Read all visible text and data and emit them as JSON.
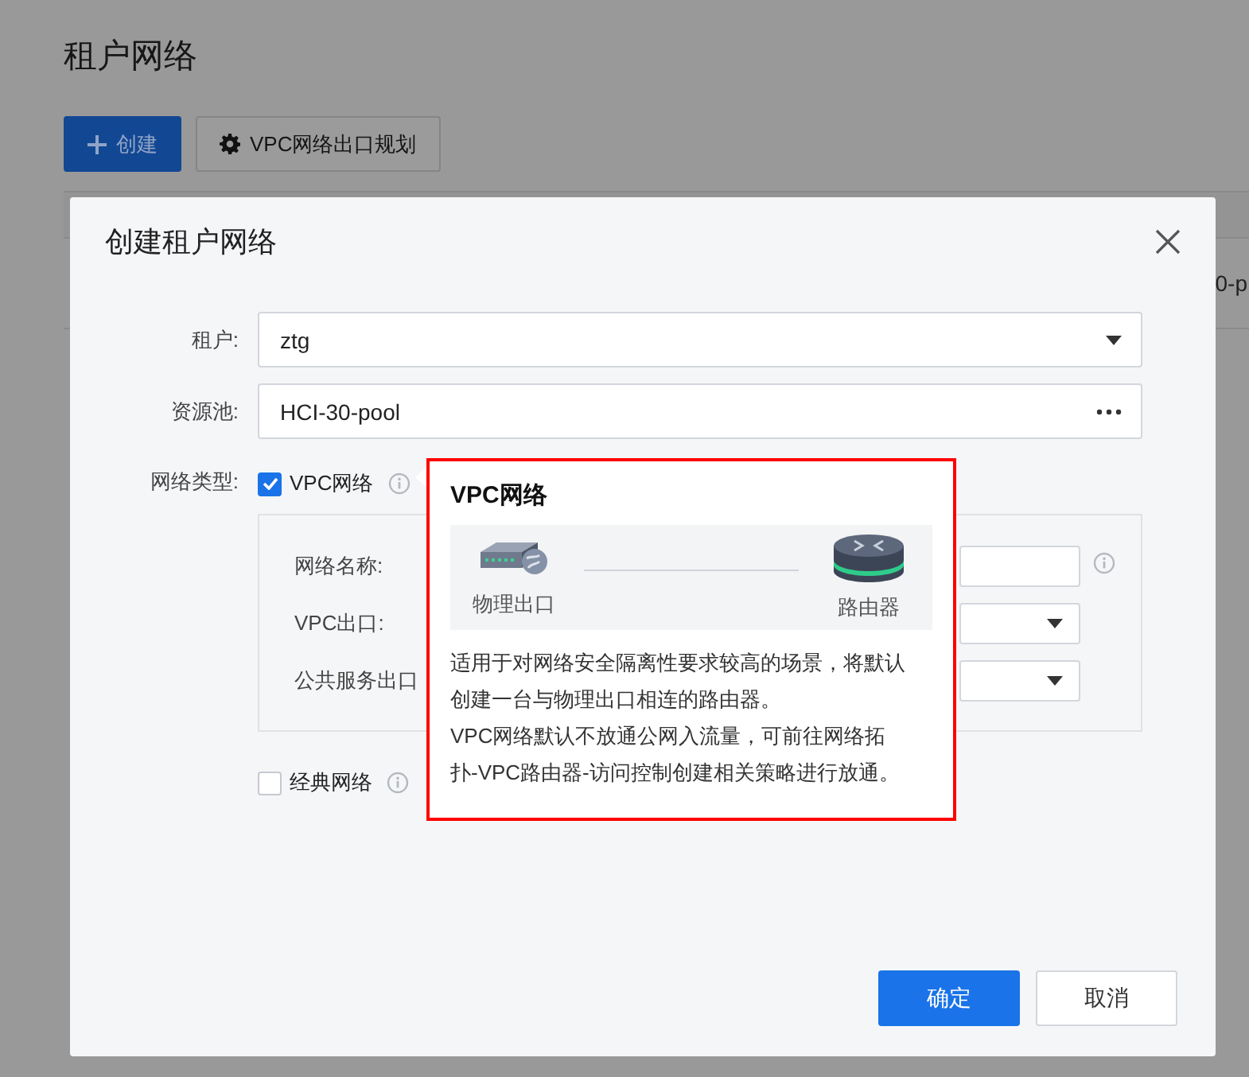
{
  "page": {
    "title": "租户网络",
    "toolbar": [
      {
        "label": "创建",
        "kind": "primary"
      },
      {
        "label": "VPC网络出口规划",
        "kind": "default"
      }
    ],
    "table": {
      "rows": [
        {
          "column_4": "0-p"
        }
      ]
    }
  },
  "dialog": {
    "title": "创建租户网络",
    "fields": [
      {
        "label": "租户:",
        "value": "ztg",
        "kind": "select"
      },
      {
        "label": "资源池:",
        "value": "HCI-30-pool",
        "kind": "picker"
      }
    ],
    "network_type": {
      "label": "网络类型:",
      "options": [
        {
          "label": "VPC网络",
          "checked": true,
          "fields": [
            {
              "label": "网络名称:",
              "kind": "input"
            },
            {
              "label": "VPC出口:",
              "kind": "select"
            },
            {
              "label": "公共服务出口",
              "kind": "select"
            }
          ]
        },
        {
          "label": "经典网络",
          "checked": false
        }
      ]
    },
    "buttons": [
      {
        "label": "确定",
        "kind": "primary"
      },
      {
        "label": "取消",
        "kind": "default"
      }
    ]
  },
  "tooltip": {
    "title": "VPC网络",
    "diagram": {
      "left": "物理出口",
      "right": "路由器"
    },
    "paragraphs": [
      "适用于对网络安全隔离性要求较高的场景，将默认创建一台与物理出口相连的路由器。",
      "VPC网络默认不放通公网入流量，可前往网络拓扑-VPC路由器-访问控制创建相关策略进行放通。"
    ]
  }
}
